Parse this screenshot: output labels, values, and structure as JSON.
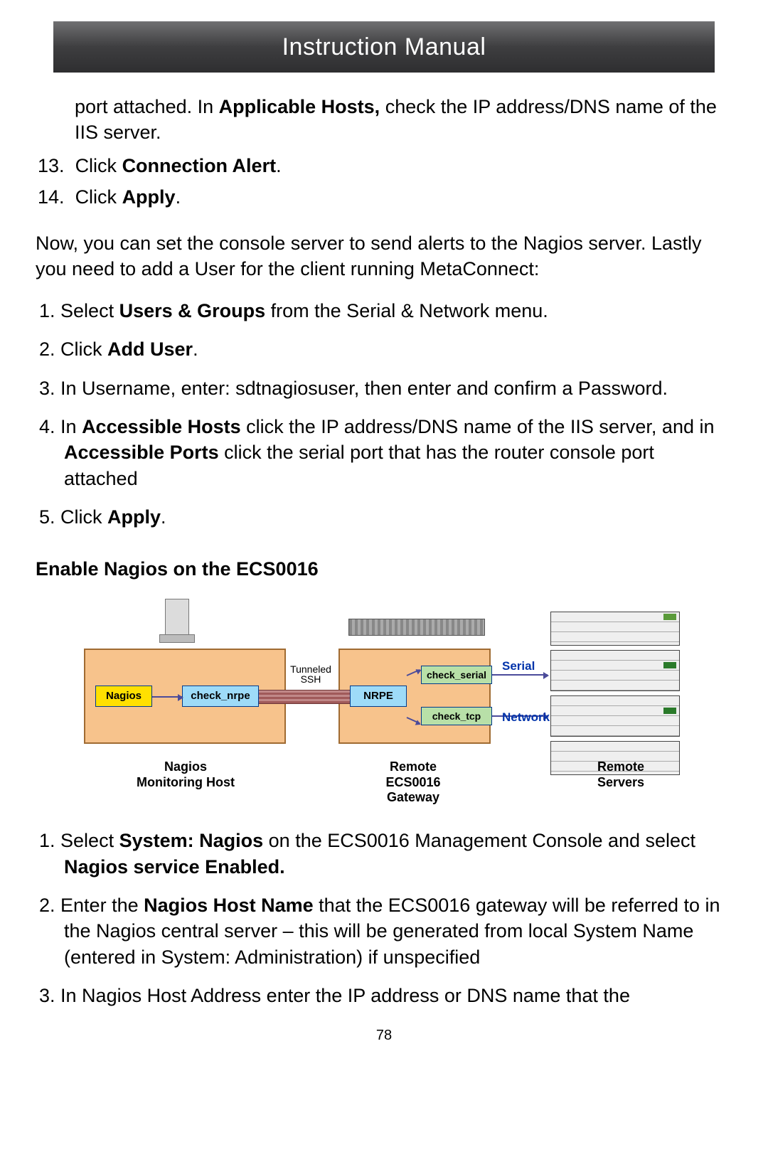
{
  "header": {
    "title": "Instruction Manual"
  },
  "intro_continuation": {
    "pre": "port attached. In ",
    "bold": "Applicable Hosts,",
    "post": " check the IP address/DNS name of the IIS server."
  },
  "list_a": [
    {
      "n": "13.",
      "pre": "Click ",
      "bold": "Connection Alert",
      "post": "."
    },
    {
      "n": "14.",
      "pre": "Click ",
      "bold": "Apply",
      "post": "."
    }
  ],
  "paragraph_1": "Now, you can set the console server to send alerts to the Nagios server. Lastly you need to add a User for the client running MetaConnect:",
  "list_b": [
    {
      "n": "1.",
      "parts": [
        {
          "t": "Select "
        },
        {
          "b": "Users & Groups"
        },
        {
          "t": " from the Serial & Network menu."
        }
      ]
    },
    {
      "n": "2.",
      "parts": [
        {
          "t": "Click "
        },
        {
          "b": "Add User"
        },
        {
          "t": "."
        }
      ]
    },
    {
      "n": "3.",
      "parts": [
        {
          "t": "In Username, enter: sdtnagiosuser, then enter and confirm a Password."
        }
      ]
    },
    {
      "n": "4.",
      "parts": [
        {
          "t": "In "
        },
        {
          "b": "Accessible Hosts"
        },
        {
          "t": " click the IP address/DNS name of the IIS server, and in "
        },
        {
          "b": "Accessible Ports"
        },
        {
          "t": " click the serial port that has the router console port attached"
        }
      ]
    },
    {
      "n": "5.",
      "parts": [
        {
          "t": "Click "
        },
        {
          "b": "Apply"
        },
        {
          "t": "."
        }
      ]
    }
  ],
  "section_heading": "Enable Nagios on the ECS0016",
  "diagram": {
    "nodes": {
      "nagios": "Nagios",
      "check_nrpe": "check_nrpe",
      "nrpe": "NRPE",
      "check_serial": "check_serial",
      "check_tcp": "check_tcp"
    },
    "labels": {
      "tunneled_ssh": "Tunneled\nSSH",
      "serial": "Serial",
      "network": "Network"
    },
    "captions": {
      "nagios_host": "Nagios\nMonitoring Host",
      "gateway": "Remote\nECS0016\nGateway",
      "remote_servers": "Remote\nServers"
    }
  },
  "list_c": [
    {
      "n": "1.",
      "parts": [
        {
          "t": "Select "
        },
        {
          "b": "System: Nagios"
        },
        {
          "t": " on the ECS0016 Management Console and select "
        },
        {
          "b": "Nagios service Enabled."
        }
      ]
    },
    {
      "n": "2.",
      "parts": [
        {
          "t": "Enter the "
        },
        {
          "b": "Nagios Host Name"
        },
        {
          "t": " that the ECS0016 gateway will be referred to in the Nagios central server – this will be generated from local System Name (entered in System: Administration) if unspecified"
        }
      ]
    },
    {
      "n": "3.",
      "parts": [
        {
          "t": "In Nagios Host Address enter the IP address or DNS name that the"
        }
      ]
    }
  ],
  "page_number": "78"
}
